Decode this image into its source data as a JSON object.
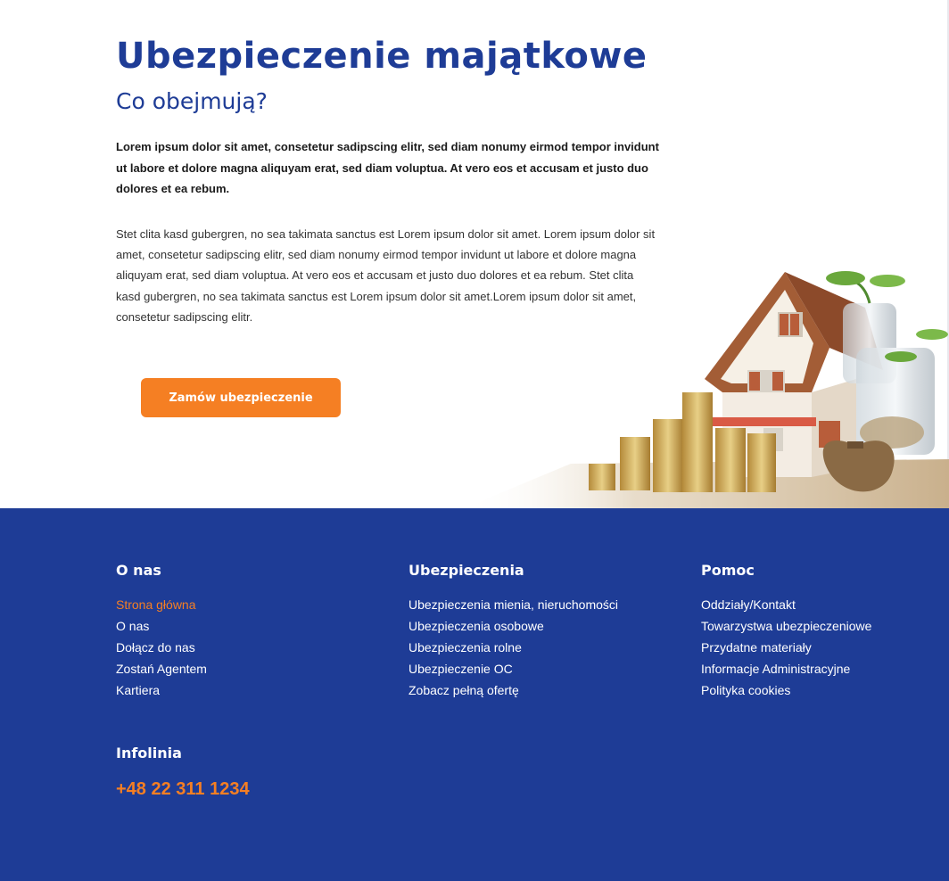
{
  "hero": {
    "title": "Ubezpieczenie majątkowe",
    "subtitle": "Co obejmują?",
    "para_bold": "Lorem ipsum dolor sit amet, consetetur sadipscing elitr, sed diam nonumy eirmod tempor invidunt ut labore et dolore magna aliquyam erat, sed diam voluptua. At vero eos et accusam et justo duo dolores et ea rebum.",
    "para_regular": "Stet clita kasd gubergren, no sea takimata sanctus est Lorem ipsum dolor sit amet. Lorem ipsum dolor sit amet, consetetur sadipscing elitr, sed diam nonumy eirmod tempor invidunt ut labore et dolore magna aliquyam erat, sed diam voluptua. At vero eos et accusam et justo duo dolores et ea rebum. Stet clita kasd gubergren, no sea takimata sanctus est Lorem ipsum dolor sit amet.Lorem ipsum dolor sit amet, consetetur sadipscing elitr.",
    "cta_label": "Zamów ubezpieczenie"
  },
  "footer": {
    "col1": {
      "title": "O nas",
      "items": [
        "Strona główna",
        "O nas",
        "Dołącz do nas",
        "Zostań Agentem",
        "Kartiera"
      ]
    },
    "col2": {
      "title": "Ubezpieczenia",
      "items": [
        "Ubezpieczenia mienia, nieruchomości",
        "Ubezpieczenia osobowe",
        "Ubezpieczenia rolne",
        "Ubezpieczenie OC",
        "Zobacz pełną ofertę"
      ]
    },
    "col3": {
      "title": "Pomoc",
      "items": [
        "Oddziały/Kontakt",
        "Towarzystwa ubezpieczeniowe",
        "Przydatne materiały",
        "Informacje Administracyjne",
        "Polityka cookies"
      ]
    },
    "infolinia_title": "Infolinia",
    "phone": "+48 22 311 1234"
  },
  "colors": {
    "brand_blue": "#1e3c96",
    "accent_orange": "#f57f23"
  }
}
